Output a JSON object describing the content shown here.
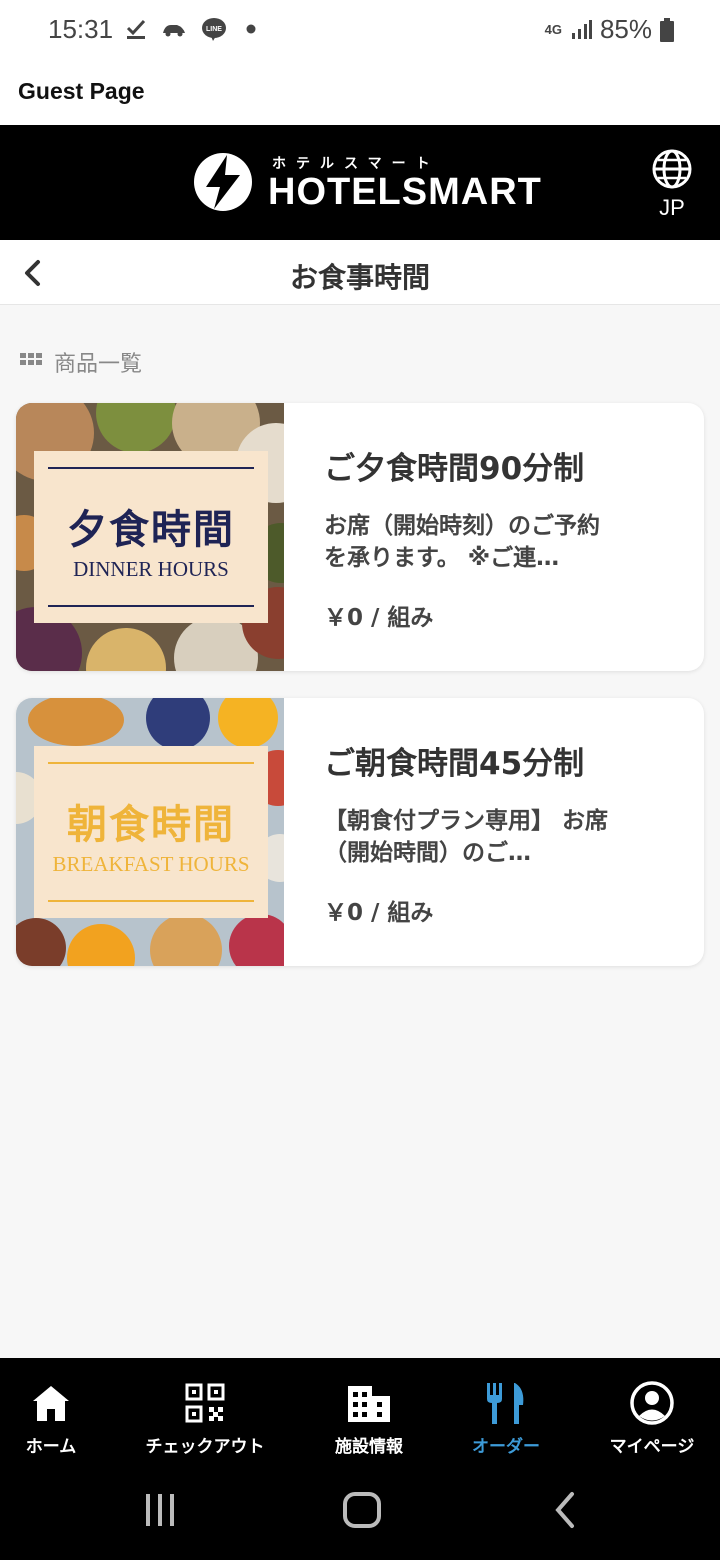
{
  "status_bar": {
    "time": "15:31",
    "network": "4G",
    "battery": "85%"
  },
  "app": {
    "guest_title": "Guest Page",
    "logo_kana": "ホテルスマート",
    "logo_text": "HOTELSMART",
    "lang": "JP"
  },
  "page": {
    "title": "お食事時間",
    "section_label": "商品一覧"
  },
  "products": [
    {
      "title": "ご夕食時間90分制",
      "desc": "お席（開始時刻）のご予約を承ります。 ※ご連…",
      "price": "￥0 / 組み",
      "img_jp": "夕食時間",
      "img_en": "DINNER HOURS"
    },
    {
      "title": "ご朝食時間45分制",
      "desc": "【朝食付プラン専用】 お席（開始時間）のご…",
      "price": "￥0 / 組み",
      "img_jp": "朝食時間",
      "img_en": "BREAKFAST HOURS"
    }
  ],
  "nav": [
    {
      "label": "ホーム",
      "icon": "home-icon"
    },
    {
      "label": "チェックアウト",
      "icon": "qr-code-icon"
    },
    {
      "label": "施設情報",
      "icon": "building-icon"
    },
    {
      "label": "オーダー",
      "icon": "fork-knife-icon",
      "active": true
    },
    {
      "label": "マイページ",
      "icon": "user-circle-icon"
    }
  ],
  "colors": {
    "accent": "#3d9bd8",
    "dinner_text": "#1f2455",
    "breakfast_text": "#efb43a",
    "ticket_bg": "#f8e5cd"
  }
}
